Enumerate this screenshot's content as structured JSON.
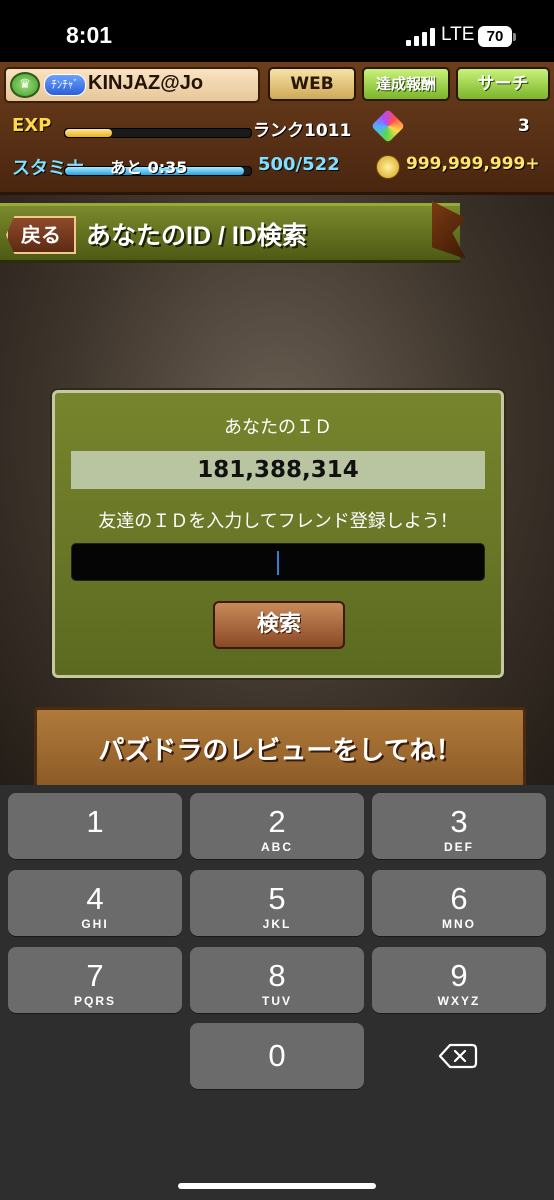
{
  "status": {
    "time": "8:01",
    "network": "LTE",
    "battery": "70"
  },
  "header": {
    "player_tag": "ﾁﾝﾁｬﾞ",
    "player_name": "KINJAZ@Jo",
    "web_label": "WEB",
    "reward_label": "達成報酬",
    "search_label": "サーチ",
    "exp_label": "EXP",
    "exp_progress": 0.25,
    "rank_text": "ランク1011",
    "stone_count": "3",
    "stamina_label": "スタミナ",
    "stamina_timer": "あと 0:35",
    "stamina_value": "500/522",
    "stamina_progress": 0.96,
    "coin_count": "999,999,999+"
  },
  "page": {
    "back_label": "戻る",
    "title": "あなたのID / ID検索"
  },
  "id_panel": {
    "your_id_label": "あなたのＩＤ",
    "your_id": "181,388,314",
    "prompt": "友達のＩＤを入力してフレンド登録しよう！",
    "input_value": "",
    "search_button": "検索"
  },
  "banner": {
    "review_text": "パズドラのレビューをしてね！"
  },
  "keyboard": {
    "keys": [
      {
        "num": "1",
        "letters": ""
      },
      {
        "num": "2",
        "letters": "ABC"
      },
      {
        "num": "3",
        "letters": "DEF"
      },
      {
        "num": "4",
        "letters": "GHI"
      },
      {
        "num": "5",
        "letters": "JKL"
      },
      {
        "num": "6",
        "letters": "MNO"
      },
      {
        "num": "7",
        "letters": "PQRS"
      },
      {
        "num": "8",
        "letters": "TUV"
      },
      {
        "num": "9",
        "letters": "WXYZ"
      },
      {
        "num": "0",
        "letters": ""
      }
    ],
    "delete_icon": "backspace-icon"
  }
}
